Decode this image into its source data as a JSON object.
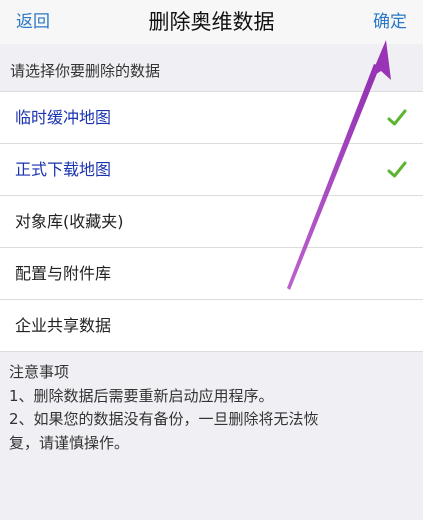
{
  "header": {
    "back_label": "返回",
    "title": "删除奥维数据",
    "confirm_label": "确定"
  },
  "section": {
    "prompt": "请选择你要删除的数据"
  },
  "items": [
    {
      "label": "临时缓冲地图",
      "selected": true
    },
    {
      "label": "正式下载地图",
      "selected": true
    },
    {
      "label": "对象库(收藏夹)",
      "selected": false
    },
    {
      "label": "配置与附件库",
      "selected": false
    },
    {
      "label": "企业共享数据",
      "selected": false
    }
  ],
  "notes": {
    "title": "注意事项",
    "line1": "1、删除数据后需要重新启动应用程序。",
    "line2": "2、如果您的数据没有备份，一旦删除将无法恢",
    "line3": "复，请谨慎操作。"
  },
  "colors": {
    "accent": "#2b78c5",
    "selected_text": "#1a33b0",
    "check": "#5cb531",
    "annotation_arrow": "#a03fb8"
  },
  "icons": {
    "check": "check-icon",
    "arrow": "annotation-arrow-icon"
  }
}
